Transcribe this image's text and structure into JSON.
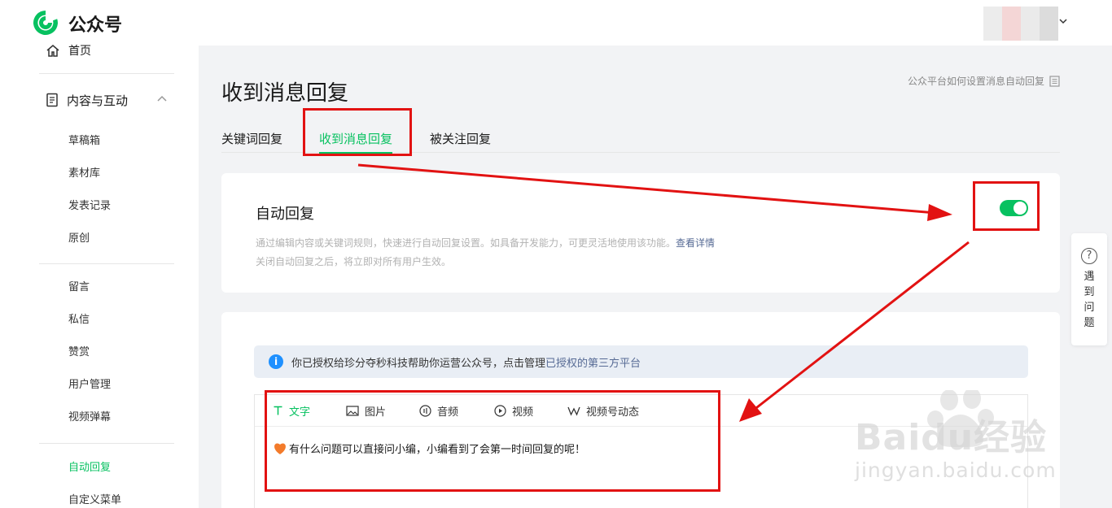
{
  "app": {
    "brand": "公众号",
    "brand_color": "#07c160"
  },
  "sidebar": {
    "home": "首页",
    "group": "内容与互动",
    "items": [
      "草稿箱",
      "素材库",
      "发表记录",
      "原创",
      "留言",
      "私信",
      "赞赏",
      "用户管理",
      "视频弹幕",
      "自动回复",
      "自定义菜单"
    ],
    "active_item": "自动回复"
  },
  "main": {
    "title": "收到消息回复",
    "help_link": "公众平台如何设置消息自动回复",
    "tabs": [
      "关键词回复",
      "收到消息回复",
      "被关注回复"
    ],
    "active_tab": "收到消息回复"
  },
  "auto_reply": {
    "title": "自动回复",
    "desc_line1": "通过编辑内容或关键词规则，快速进行自动回复设置。如具备开发能力，可更灵活地使用该功能。",
    "desc_link": "查看详情",
    "desc_line2": "关闭自动回复之后，将立即对所有用户生效。",
    "enabled": true
  },
  "notice": {
    "text": "你已授权给珍分夺秒科技帮助你运营公众号，点击管理",
    "link": "已授权的第三方平台"
  },
  "editor": {
    "tabs": [
      "文字",
      "图片",
      "音频",
      "视频",
      "视频号动态"
    ],
    "active_tab": "文字",
    "content": "有什么问题可以直接问小编，小编看到了会第一时间回复的呢！"
  },
  "float_help": {
    "label": "遇到问题"
  },
  "watermark": {
    "text": "Baidu经验",
    "url": "jingyan.baidu.com"
  },
  "annotation_color": "#e21212"
}
